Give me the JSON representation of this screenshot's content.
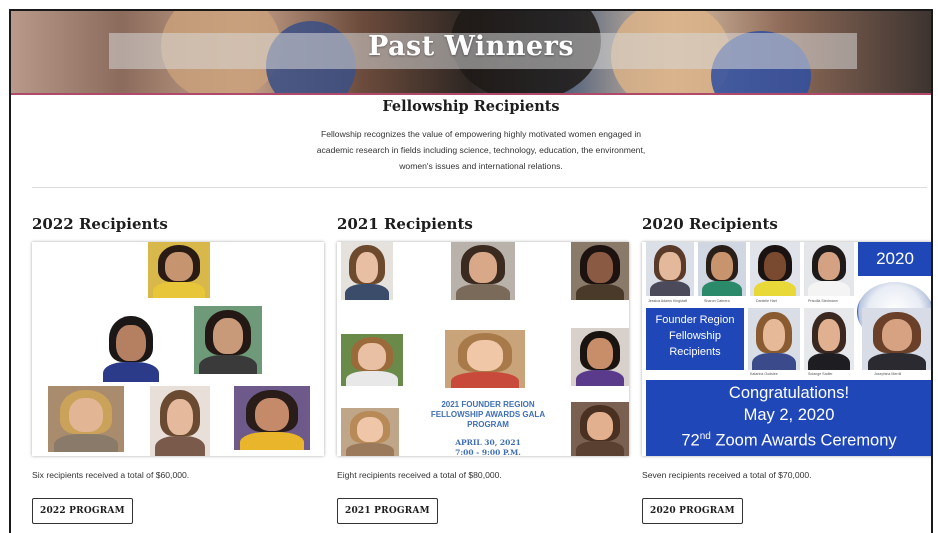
{
  "hero": {
    "title": "Past Winners"
  },
  "section": {
    "title": "Fellowship Recipients",
    "intro_lines": [
      "Fellowship recognizes the value of empowering highly motivated women engaged in",
      "academic research in fields including science, technology, education, the environment,",
      "women's issues and international relations."
    ]
  },
  "columns": [
    {
      "heading": "2022 Recipients",
      "summary": "Six recipients received a total of $60,000.",
      "button": "2022 PROGRAM"
    },
    {
      "heading": "2021 Recipients",
      "summary": "Eight recipients received a total of $80,000.",
      "button": "2021 PROGRAM",
      "program_lines": [
        "2021 FOUNDER REGION",
        "FELLOWSHIP AWARDS GALA",
        "PROGRAM"
      ],
      "program_date_lines": [
        "APRIL 30, 2021",
        "7:00 - 9:00 P.M."
      ]
    },
    {
      "heading": "2020 Recipients",
      "summary": "Seven recipients received a total of $70,000.",
      "button": "2020 PROGRAM",
      "year_box": "2020",
      "founder_lines": [
        "Founder Region",
        "Fellowship",
        "Recipients"
      ],
      "congrats_lines": [
        "Congratulations!",
        "May 2, 2020"
      ],
      "ceremony": {
        "number": "72",
        "suffix": "nd",
        "rest": " Zoom Awards Ceremony"
      },
      "photo_captions": [
        "Jessica Adams Kingstaff",
        "Sharon Cabrera",
        "Danielle Hart",
        "Priscilla Stedmann",
        "Katarina Godslee",
        "Solange Sadler",
        "Josephina Merrill"
      ]
    }
  ]
}
